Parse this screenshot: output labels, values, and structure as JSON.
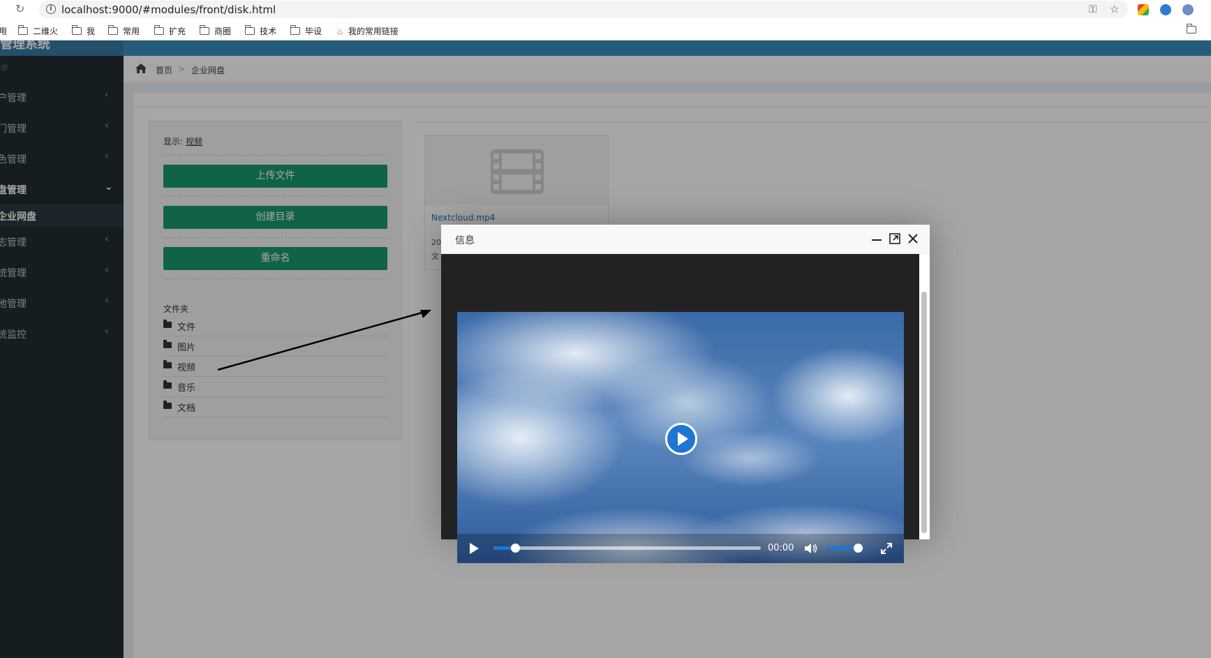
{
  "browser": {
    "url": "localhost:9000/#modules/front/disk.html",
    "bookmarks": [
      {
        "label": "用"
      },
      {
        "label": "二维火"
      },
      {
        "label": "我"
      },
      {
        "label": "常用"
      },
      {
        "label": "扩充"
      },
      {
        "label": "商圈"
      },
      {
        "label": "技术"
      },
      {
        "label": "毕设"
      },
      {
        "label": "我的常用链接"
      }
    ]
  },
  "sidebar": {
    "header": "单",
    "items": [
      {
        "label": "户管理"
      },
      {
        "label": "门管理"
      },
      {
        "label": "色管理"
      },
      {
        "label": "盘管理"
      },
      {
        "label": "志管理"
      },
      {
        "label": "统管理"
      },
      {
        "label": "他管理"
      },
      {
        "label": "统监控"
      }
    ],
    "sub_active": "企业网盘"
  },
  "breadcrumb": {
    "home": "首页",
    "separator": ">",
    "current": "企业网盘"
  },
  "left_panel": {
    "show_label": "显示:",
    "show_value": "视频",
    "buttons": {
      "upload": "上传文件",
      "mkdir": "创建目录",
      "rename": "重命名"
    },
    "folders_title": "文件夹",
    "folders": [
      {
        "label": "文件"
      },
      {
        "label": "图片"
      },
      {
        "label": "视频"
      },
      {
        "label": "音乐"
      },
      {
        "label": "文档"
      }
    ]
  },
  "file_card": {
    "name": "Nextcloud.mp4",
    "meta_line1": "20",
    "meta_line2": "文"
  },
  "dialog": {
    "title": "信息",
    "video": {
      "time": "00:00",
      "progress": 0.08,
      "volume": 0.8
    }
  },
  "colors": {
    "topbar": "#3c8dbc",
    "sidebar": "#222d32",
    "button": "#1a9a6b",
    "video_accent": "#1d76d2"
  }
}
